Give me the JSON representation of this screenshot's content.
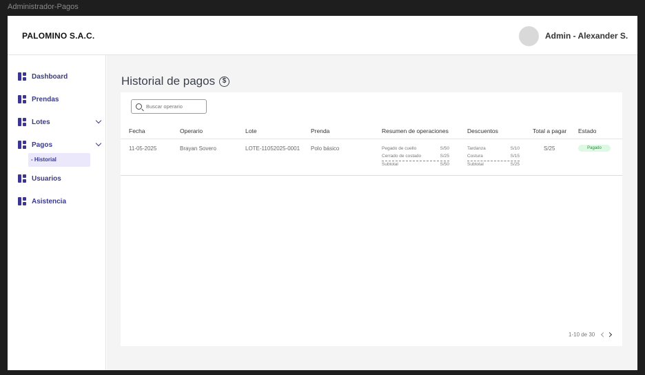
{
  "window": {
    "title": "Administrador-Pagos"
  },
  "header": {
    "brand": "PALOMINO S.A.C.",
    "user": "Admin - Alexander S."
  },
  "sidebar": {
    "items": [
      {
        "label": "Dashboard",
        "icon": "dashboard-icon"
      },
      {
        "label": "Prendas",
        "icon": "dashboard-icon"
      },
      {
        "label": "Lotes",
        "icon": "dashboard-icon"
      },
      {
        "label": "Pagos",
        "icon": "dashboard-icon"
      },
      {
        "label": "Usuarios",
        "icon": "dashboard-icon"
      },
      {
        "label": "Asistencia",
        "icon": "dashboard-icon"
      }
    ],
    "subitem": "- Historial"
  },
  "main": {
    "title": "Historial de pagos",
    "title_icon": "$",
    "search_placeholder": "Buscar operario",
    "columns": [
      "Fecha",
      "Operario",
      "Lote",
      "Prenda",
      "Resumen de operaciones",
      "Descuentos",
      "Total a pagar",
      "Estado"
    ],
    "row": {
      "fecha": "11-05-2025",
      "operario": "Brayan Sovero",
      "lote": "LOTE-11052025-0001",
      "prenda": "Polo básico",
      "ops": [
        {
          "name": "Pegado de cuello",
          "amount": "S/50"
        },
        {
          "name": "Cerrado de costado",
          "amount": "S/25"
        }
      ],
      "ops_subtotal": {
        "name": "Subtotal",
        "amount": "S/50"
      },
      "desc": [
        {
          "name": "Tardanza",
          "amount": "S/10"
        },
        {
          "name": "Costura",
          "amount": "S/15"
        }
      ],
      "desc_subtotal": {
        "name": "Subtotal",
        "amount": "S/25"
      },
      "total": "S/25",
      "estado": "Pagado"
    },
    "pagination": "1-10 de 30"
  },
  "colors": {
    "accent": "#3d3594",
    "badge_bg": "#ddf8e3",
    "badge_text": "#2f8a46"
  }
}
